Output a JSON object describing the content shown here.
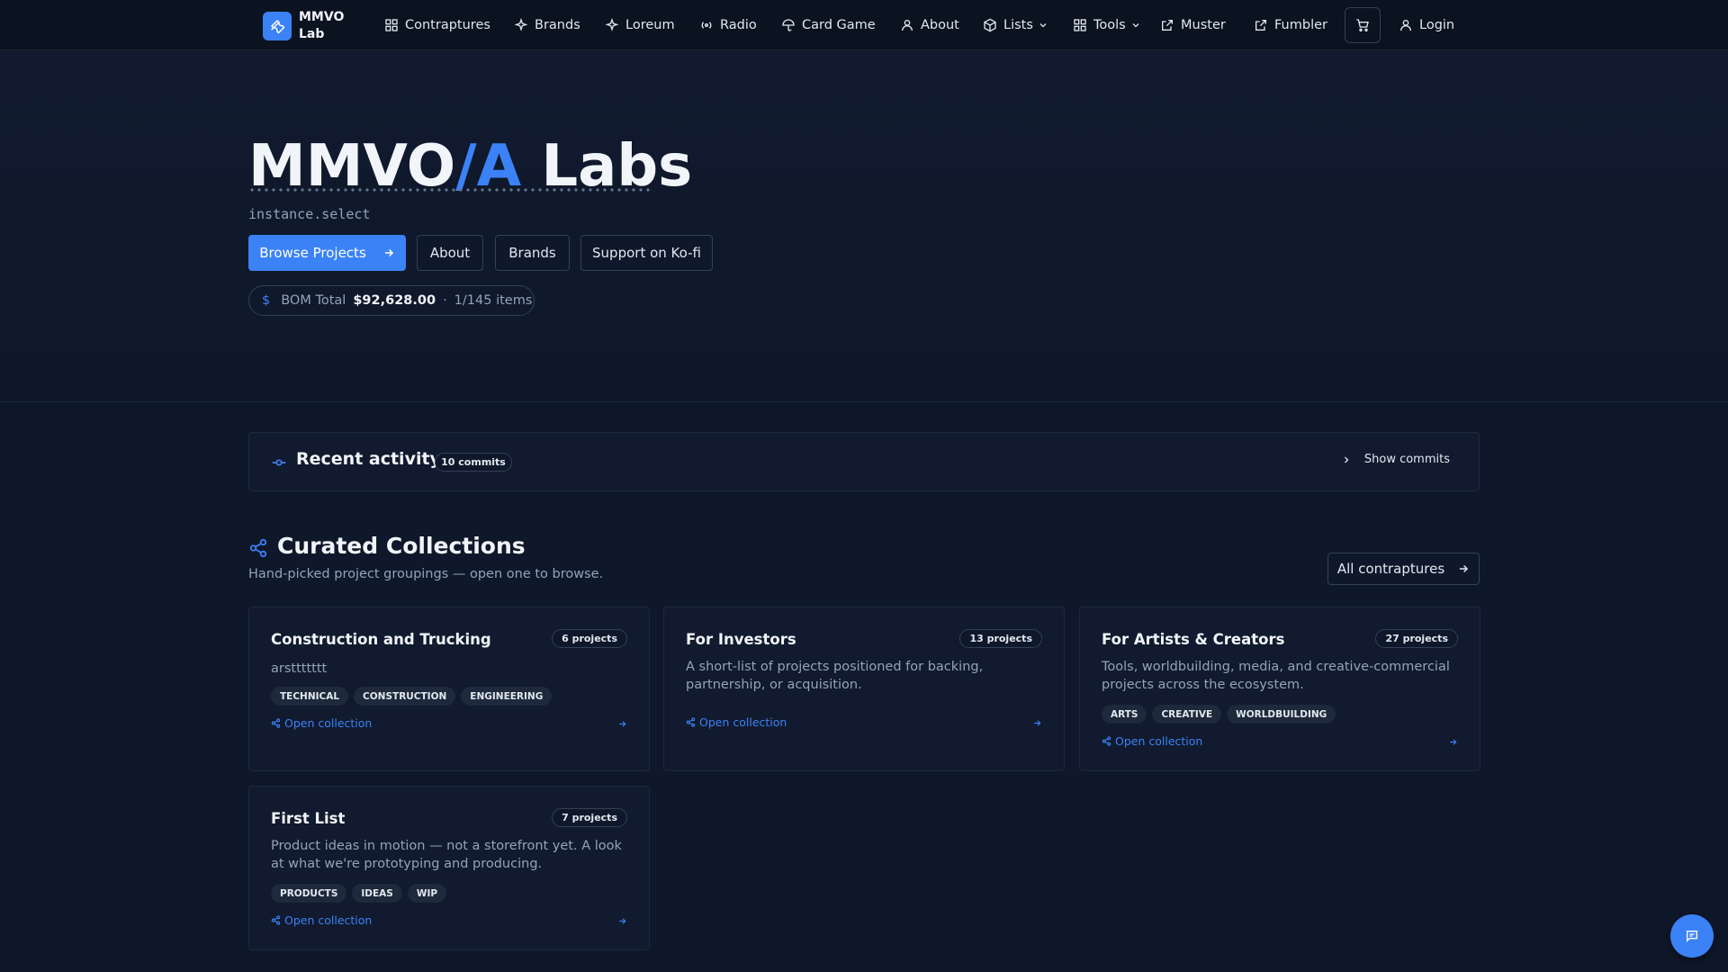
{
  "brand": {
    "name_line1": "MMVO",
    "name_line2": "Lab",
    "logo_icon": "wrench-icon"
  },
  "nav": {
    "items": [
      {
        "label": "Contraptures",
        "icon": "grid-icon"
      },
      {
        "label": "Brands",
        "icon": "sparkle-icon"
      },
      {
        "label": "Loreum",
        "icon": "sparkle-icon"
      },
      {
        "label": "Radio",
        "icon": "radio-icon"
      },
      {
        "label": "Card Game",
        "icon": "umbrella-icon"
      },
      {
        "label": "About",
        "icon": "user-icon"
      },
      {
        "label": "Lists",
        "icon": "box-icon",
        "dropdown": true
      },
      {
        "label": "Tools",
        "icon": "grid-icon",
        "dropdown": true
      },
      {
        "label": "Muster",
        "icon": "external-link-icon"
      },
      {
        "label": "Fumbler",
        "icon": "external-link-icon"
      }
    ],
    "cart_icon": "cart-icon",
    "login_label": "Login"
  },
  "hero": {
    "title_part1": "MMVO",
    "title_accent": "/A",
    "title_part2": " Labs",
    "subtitle": "instance.select",
    "buttons": {
      "browse": "Browse Projects",
      "about": "About",
      "brands": "Brands",
      "kofi": "Support on Ko-fi"
    },
    "bom": {
      "currency_symbol": "$",
      "label": "BOM Total",
      "total": "$92,628.00",
      "separator": "·",
      "items": "1/145 items"
    }
  },
  "activity": {
    "title": "Recent activity",
    "commits_badge": "10 commits",
    "toggle_label": "Show commits"
  },
  "collections": {
    "title": "Curated Collections",
    "subtitle": "Hand-picked project groupings — open one to browse.",
    "all_button": "All contraptures",
    "open_label": "Open collection",
    "cards": [
      {
        "title": "Construction and Trucking",
        "count": "6 projects",
        "description": "arsttttttt",
        "tags": [
          "TECHNICAL",
          "CONSTRUCTION",
          "ENGINEERING"
        ]
      },
      {
        "title": "For Investors",
        "count": "13 projects",
        "description": "A short-list of projects positioned for backing, partnership, or acquisition.",
        "tags": []
      },
      {
        "title": "For Artists & Creators",
        "count": "27 projects",
        "description": "Tools, worldbuilding, media, and creative-commercial projects across the ecosystem.",
        "tags": [
          "ARTS",
          "CREATIVE",
          "WORLDBUILDING"
        ]
      },
      {
        "title": "First List",
        "count": "7 projects",
        "description": "Product ideas in motion — not a storefront yet. A look at what we're prototyping and producing.",
        "tags": [
          "PRODUCTS",
          "IDEAS",
          "WIP"
        ]
      }
    ]
  },
  "colors": {
    "accent": "#3b82f6",
    "background": "#0f172a",
    "card": "#111a2e"
  }
}
